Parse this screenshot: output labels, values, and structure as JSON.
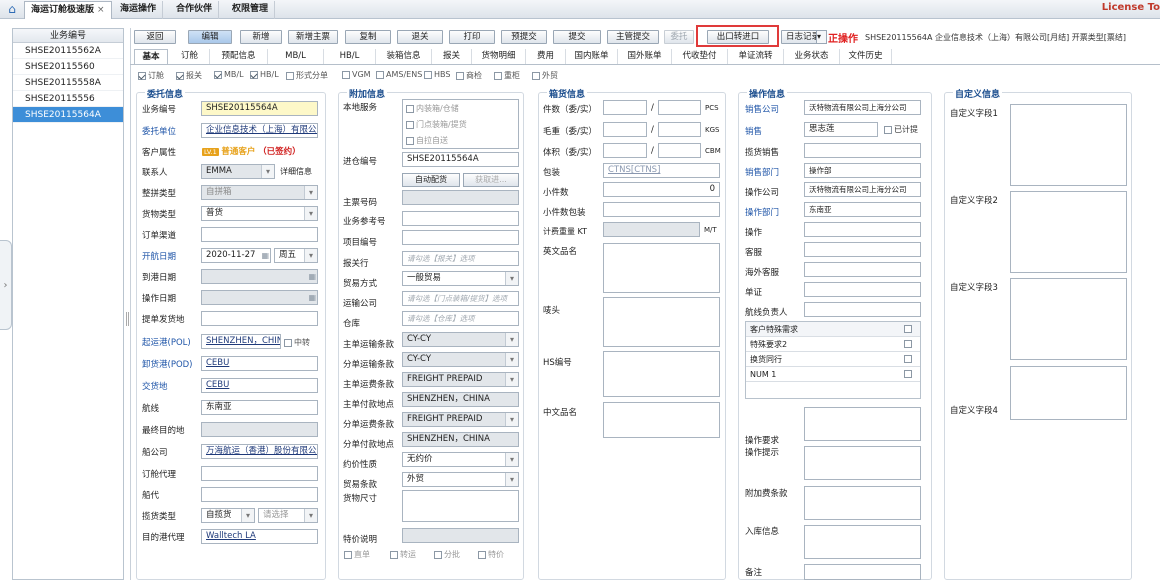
{
  "tabs": [
    {
      "label": "海运订舱极速版"
    },
    {
      "label": "海运操作"
    },
    {
      "label": "合作伙伴"
    },
    {
      "label": "权限管理"
    }
  ],
  "license": "License To",
  "list": {
    "header": "业务编号",
    "items": [
      "SHSE20115562A",
      "SHSE20115560",
      "SHSE20115558A",
      "SHSE20115556",
      "SHSE20115564A"
    ]
  },
  "toolbar": [
    "返回",
    "编辑",
    "新增",
    "新增主票",
    "复制",
    "退关",
    "打印",
    "预提交",
    "提交",
    "主管提交",
    "委托",
    "出口转进口",
    "日志记录"
  ],
  "status": {
    "warn": "正操作",
    "info": "SHSE20115564A  企业信息技术（上海）有限公司[月结]  开票类型[票结]"
  },
  "navtabs": [
    "基本",
    "订舱",
    "预配信息",
    "MB/L",
    "HB/L",
    "装箱信息",
    "报关",
    "货物明细",
    "费用",
    "国内账单",
    "国外账单",
    "代收垫付",
    "单证流转",
    "业务状态",
    "文件历史"
  ],
  "options": [
    {
      "label": "订舱",
      "on": true
    },
    {
      "label": "报关",
      "on": true
    },
    {
      "label": "MB/L",
      "on": true
    },
    {
      "label": "HB/L",
      "on": true
    },
    {
      "label": "形式分单",
      "on": false
    },
    {
      "label": "VGM",
      "on": false
    },
    {
      "label": "AMS/ENS",
      "on": false
    },
    {
      "label": "HBS",
      "on": false
    },
    {
      "label": "商检",
      "on": false
    },
    {
      "label": "重柜",
      "on": false
    },
    {
      "label": "外贸",
      "on": false
    }
  ],
  "sec1": {
    "title": "委托信息",
    "fields": {
      "bizno": {
        "label": "业务编号",
        "value": "SHSE20115564A"
      },
      "client": {
        "label": "委托单位",
        "value": "企业信息技术（上海）有限公司"
      },
      "attr": {
        "label": "客户属性",
        "badge": "LV.1",
        "grade": "普通客户",
        "signed": "（已签约）"
      },
      "contact": {
        "label": "联系人",
        "value": "EMMA",
        "link": "详细信息"
      },
      "boxtype": {
        "label": "整拼类型",
        "value": "自拼箱"
      },
      "goodstype": {
        "label": "货物类型",
        "value": "普货"
      },
      "channel": {
        "label": "订单渠道",
        "value": ""
      },
      "sailing": {
        "label": "开航日期",
        "value": "2020-11-27",
        "week": "周五"
      },
      "arrive": {
        "label": "到港日期",
        "value": ""
      },
      "opdate": {
        "label": "操作日期",
        "value": ""
      },
      "pickup": {
        "label": "提单发货地",
        "value": ""
      },
      "pol": {
        "label": "起运港(POL)",
        "value": "SHENZHEN，CHINA",
        "transfer": "中转"
      },
      "pod": {
        "label": "卸货港(POD)",
        "value": "CEBU"
      },
      "delivery": {
        "label": "交货地",
        "value": "CEBU"
      },
      "route": {
        "label": "航线",
        "value": "东南亚"
      },
      "final": {
        "label": "最终目的地",
        "value": ""
      },
      "carrier": {
        "label": "船公司",
        "value": "万海航运（香港）股份有限公司"
      },
      "bookagent": {
        "label": "订舱代理",
        "value": ""
      },
      "shipagent": {
        "label": "船代",
        "value": ""
      },
      "solicit": {
        "label": "揽货类型",
        "value": "自揽货",
        "value2": "请选择"
      },
      "destagent": {
        "label": "目的港代理",
        "value": "Walltech LA"
      }
    }
  },
  "sec2": {
    "title": "附加信息",
    "fields": {
      "local": {
        "label": "本地服务",
        "opts": [
          "内装箱/仓储",
          "门点装箱/提货",
          "自拉自送"
        ]
      },
      "warehouse": {
        "label": "进仓编号",
        "value": "SHSE20115564A",
        "btn1": "自动配货",
        "btn2": "获取进..."
      },
      "mainno": {
        "label": "主票号码",
        "value": ""
      },
      "bizref": {
        "label": "业务参考号",
        "value": ""
      },
      "proj": {
        "label": "项目编号",
        "value": ""
      },
      "customs": {
        "label": "报关行",
        "value": "请勾选【报关】选项"
      },
      "trade": {
        "label": "贸易方式",
        "value": "一般贸易"
      },
      "transport": {
        "label": "运输公司",
        "value": "请勾选【门点装箱/提货】选项"
      },
      "storage": {
        "label": "仓库",
        "value": "请勾选【仓库】选项"
      },
      "mtrans": {
        "label": "主单运输条款",
        "value": "CY-CY"
      },
      "strans": {
        "label": "分单运输条款",
        "value": "CY-CY"
      },
      "mfreight": {
        "label": "主单运费条款",
        "value": "FREIGHT PREPAID"
      },
      "mpay": {
        "label": "主单付款地点",
        "value": "SHENZHEN，CHINA"
      },
      "sfreight": {
        "label": "分单运费条款",
        "value": "FREIGHT PREPAID"
      },
      "spay": {
        "label": "分单付款地点",
        "value": "SHENZHEN，CHINA"
      },
      "contract": {
        "label": "约价性质",
        "value": "无约价"
      },
      "tradeterm": {
        "label": "贸易条款",
        "value": "外贸"
      },
      "size": {
        "label": "货物尺寸",
        "value": ""
      },
      "special": {
        "label": "特价说明",
        "value": ""
      },
      "bottom": [
        "直单",
        "转运",
        "分批",
        "特价"
      ]
    }
  },
  "sec3": {
    "title": "箱货信息",
    "fields": {
      "pieces": {
        "label": "件数（委/实）",
        "unit": "PCS"
      },
      "gross": {
        "label": "毛重（委/实）",
        "unit": "KGS"
      },
      "volume": {
        "label": "体积（委/实）",
        "unit": "CBM"
      },
      "pack": {
        "label": "包装",
        "value": "CTNS[CTNS]"
      },
      "small": {
        "label": "小件数",
        "value": "0"
      },
      "smallpack": {
        "label": "小件数包装",
        "value": ""
      },
      "chargew": {
        "label": "计费重量 KT",
        "unit": "M/T"
      },
      "ename": {
        "label": "英文品名"
      },
      "mark": {
        "label": "唛头"
      },
      "hs": {
        "label": "HS编号"
      },
      "cname": {
        "label": "中文品名"
      }
    }
  },
  "sec4": {
    "title": "操作信息",
    "fields": {
      "salesco": {
        "label": "销售公司",
        "value": "沃特物流有限公司上海分公司"
      },
      "sales": {
        "label": "销售",
        "value": "思志莲",
        "cb": "已计提"
      },
      "solicitsales": {
        "label": "揽货销售",
        "value": ""
      },
      "salesdept": {
        "label": "销售部门",
        "value": "操作部"
      },
      "opco": {
        "label": "操作公司",
        "value": "沃特物流有限公司上海分公司"
      },
      "opdept": {
        "label": "操作部门",
        "value": "东南亚"
      },
      "op": {
        "label": "操作",
        "value": ""
      },
      "cs": {
        "label": "客服",
        "value": ""
      },
      "oscs": {
        "label": "海外客服",
        "value": ""
      },
      "doc": {
        "label": "单证",
        "value": ""
      },
      "routeowner": {
        "label": "航线负责人",
        "value": ""
      },
      "reqtable": [
        "客户特殊需求",
        "特殊要求2",
        "换货同行",
        "NUM 1"
      ],
      "opreq": {
        "label": "操作要求"
      },
      "optip": {
        "label": "操作提示"
      },
      "extra": {
        "label": "附加费条款"
      },
      "instore": {
        "label": "入库信息"
      },
      "remark": {
        "label": "备注"
      }
    }
  },
  "sec5": {
    "title": "自定义信息",
    "fields": [
      "自定义字段1",
      "自定义字段2",
      "自定义字段3",
      "自定义字段4"
    ]
  }
}
